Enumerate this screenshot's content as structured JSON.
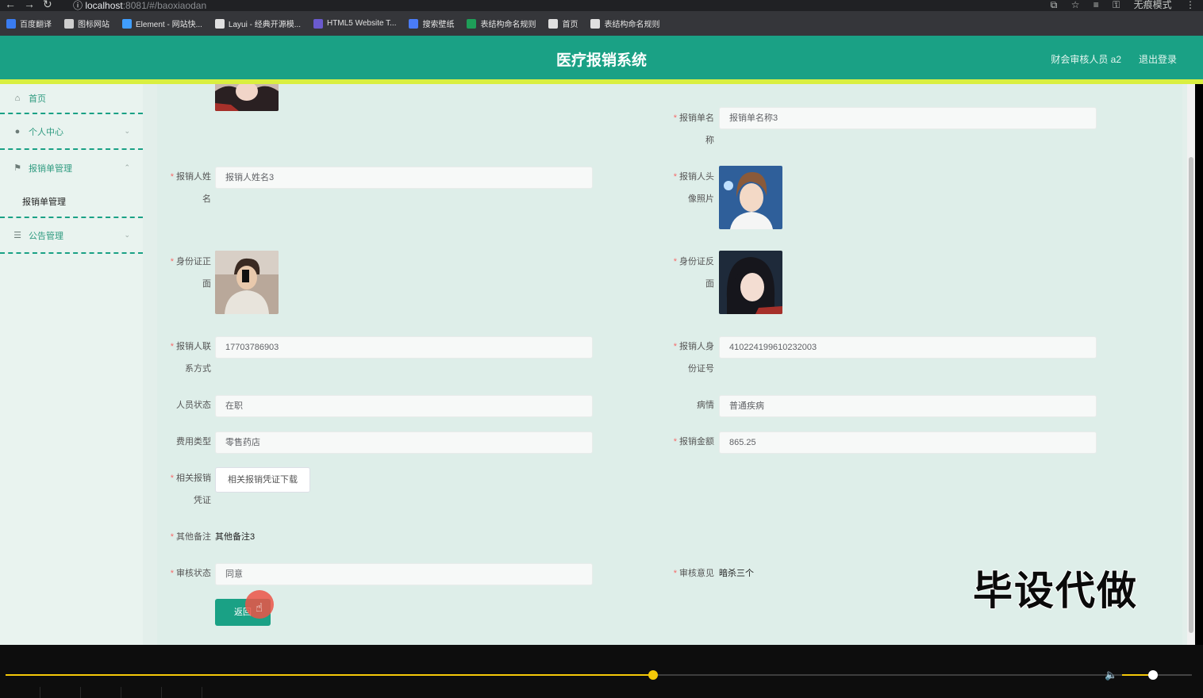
{
  "browser": {
    "url_host": "localhost",
    "url_rest": ":8081/#/baoxiaodan",
    "profile_label": "无痕模式",
    "bookmarks": [
      {
        "label": "百度翻译",
        "icon": "translate-icon",
        "color": "#3a7cf0"
      },
      {
        "label": "图标网站",
        "icon": "folder-icon",
        "color": "#cfcfcf"
      },
      {
        "label": "Element - 网站快...",
        "icon": "element-icon",
        "color": "#409eff"
      },
      {
        "label": "Layui - 经典开源模...",
        "icon": "layui-icon",
        "color": "#e0e0e0"
      },
      {
        "label": "HTML5 Website T...",
        "icon": "html5-icon",
        "color": "#6a5acd"
      },
      {
        "label": "搜索壁纸",
        "icon": "wallpaper-icon",
        "color": "#4a7cf7"
      },
      {
        "label": "表结构命名规则",
        "icon": "sheet-icon",
        "color": "#1e9e58"
      },
      {
        "label": "首页",
        "icon": "globe-icon",
        "color": "#e0e0e0"
      },
      {
        "label": "表结构命名规则",
        "icon": "globe-icon",
        "color": "#e0e0e0"
      }
    ]
  },
  "header": {
    "title": "医疗报销系统",
    "user": "财会审核人员 a2",
    "logout": "退出登录"
  },
  "sidebar": {
    "items": [
      {
        "label": "首页",
        "icon": "home-icon"
      },
      {
        "label": "个人中心",
        "icon": "user-icon",
        "arrow": "⌄"
      },
      {
        "label": "报销单管理",
        "icon": "flag-icon",
        "arrow": "⌃"
      },
      {
        "label": "公告管理",
        "icon": "sliders-icon",
        "arrow": "⌄"
      }
    ],
    "submenu": {
      "label": "报销单管理"
    }
  },
  "form": {
    "baoxiao_name": {
      "label1": "报销单名",
      "label2": "称",
      "value": "报销单名称3"
    },
    "person_name": {
      "label1": "报销人姓",
      "label2": "名",
      "value": "报销人姓名3"
    },
    "person_avatar": {
      "label1": "报销人头",
      "label2": "像照片"
    },
    "id_front": {
      "label1": "身份证正",
      "label2": "面"
    },
    "id_back": {
      "label1": "身份证反",
      "label2": "面"
    },
    "contact": {
      "label1": "报销人联",
      "label2": "系方式",
      "value": "17703786903"
    },
    "id_number": {
      "label1": "报销人身",
      "label2": "份证号",
      "value": "410224199610232003"
    },
    "status": {
      "label": "人员状态",
      "value": "在职"
    },
    "illness": {
      "label": "病情",
      "value": "普通疾病"
    },
    "fee_type": {
      "label": "费用类型",
      "value": "零售药店"
    },
    "amount": {
      "label": "报销金额",
      "value": "865.25"
    },
    "voucher": {
      "label1": "相关报销",
      "label2": "凭证",
      "button": "相关报销凭证下载"
    },
    "remark": {
      "label": "其他备注",
      "value": "其他备注3"
    },
    "review_status": {
      "label": "审核状态",
      "value": "同意"
    },
    "review_opinion": {
      "label": "审核意见",
      "value": "暗杀三个"
    },
    "back_button": "返回"
  },
  "watermark": "毕设代做",
  "player": {
    "progress": 0.546,
    "volume": 0.45
  }
}
